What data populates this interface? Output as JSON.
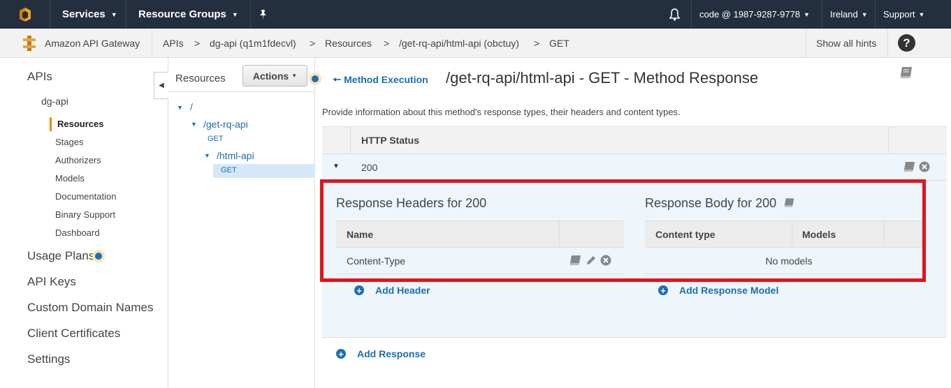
{
  "topnav": {
    "services": "Services",
    "resource_groups": "Resource Groups",
    "account": "code @ 1987-9287-9778",
    "region": "Ireland",
    "support": "Support"
  },
  "crumbs": {
    "service": "Amazon API Gateway",
    "items": [
      "APIs",
      ">",
      "dg-api (q1m1fdecvl)",
      ">",
      "Resources",
      ">",
      "/get-rq-api/html-api (obctuy)",
      ">",
      "GET"
    ],
    "hints": "Show all hints",
    "help": "?"
  },
  "sidebar": {
    "apis": "APIs",
    "api_name": "dg-api",
    "sub": [
      "Resources",
      "Stages",
      "Authorizers",
      "Models",
      "Documentation",
      "Binary Support",
      "Dashboard"
    ],
    "items": [
      "Usage Plans",
      "API Keys",
      "Custom Domain Names",
      "Client Certificates",
      "Settings"
    ]
  },
  "tree": {
    "title": "Resources",
    "actions": "Actions",
    "root": "/",
    "res1": "/get-rq-api",
    "res1_method": "GET",
    "res2": "/html-api",
    "res2_method": "GET"
  },
  "main": {
    "back": "Method Execution",
    "title": "/get-rq-api/html-api - GET - Method Response",
    "description": "Provide information about this method's response types, their headers and content types.",
    "col_http_status": "HTTP Status",
    "status": "200",
    "headers_title": "Response Headers for 200",
    "headers_col_name": "Name",
    "header_value": "Content-Type",
    "add_header": "Add Header",
    "body_title": "Response Body for 200",
    "body_col_content": "Content type",
    "body_col_models": "Models",
    "no_models": "No models",
    "add_model": "Add Response Model",
    "add_response": "Add Response"
  },
  "colors": {
    "topbar": "#232f3e",
    "link": "#1a6fb3",
    "highlight": "#e0141e",
    "accent": "#e88b00"
  }
}
